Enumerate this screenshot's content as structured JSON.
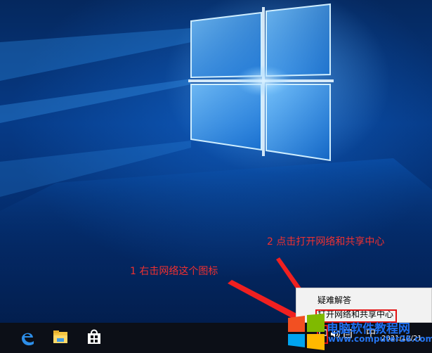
{
  "context_menu": {
    "items": [
      {
        "label": "疑难解答"
      },
      {
        "label": "打开网络和共享中心"
      }
    ]
  },
  "taskbar": {
    "apps": [
      {
        "icon": "edge-icon"
      },
      {
        "icon": "file-explorer-icon"
      },
      {
        "icon": "store-icon"
      }
    ],
    "tray": {
      "network_icon": "network-icon",
      "volume_icon": "volume-icon",
      "notification_icon": "notification-icon",
      "ime_label": "中",
      "date": "2021/12/21"
    }
  },
  "annotations": {
    "step1": "1 右击网络这个图标",
    "step2": "2 点击打开网络和共享中心"
  },
  "watermark": {
    "title": "电脑软件教程网",
    "url": "www.computer26.com"
  },
  "colors": {
    "annotation": "#f03030",
    "highlight": "#e21313",
    "taskbar": "#0c0f17",
    "watermark": "#1e6ff0"
  }
}
